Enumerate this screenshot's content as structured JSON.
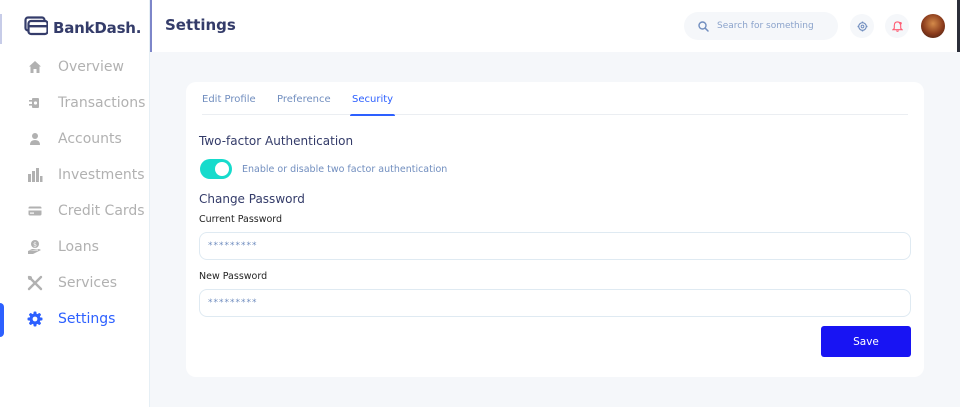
{
  "app": {
    "name": "BankDash."
  },
  "sidebar": {
    "items": [
      {
        "label": "Overview",
        "icon": "home-icon"
      },
      {
        "label": "Transactions",
        "icon": "transfer-icon"
      },
      {
        "label": "Accounts",
        "icon": "user-icon"
      },
      {
        "label": "Investments",
        "icon": "investment-icon"
      },
      {
        "label": "Credit Cards",
        "icon": "credit-card-icon"
      },
      {
        "label": "Loans",
        "icon": "loan-icon"
      },
      {
        "label": "Services",
        "icon": "services-icon"
      },
      {
        "label": "Settings",
        "icon": "gear-icon",
        "active": true
      }
    ]
  },
  "header": {
    "title": "Settings",
    "search_placeholder": "Search for something"
  },
  "tabs": [
    {
      "label": "Edit Profile"
    },
    {
      "label": "Preference"
    },
    {
      "label": "Security",
      "active": true
    }
  ],
  "security": {
    "two_factor_title": "Two-factor Authentication",
    "two_factor_enabled": true,
    "two_factor_label": "Enable or disable two factor authentication",
    "change_password_title": "Change Password",
    "current_password_label": "Current Password",
    "current_password_value": "*********",
    "new_password_label": "New Password",
    "new_password_value": "*********",
    "save_label": "Save"
  },
  "colors": {
    "accent": "#2d60ff",
    "toggle": "#16dbcc",
    "save_button": "#1814f3",
    "muted": "#b1b1b1",
    "text_secondary": "#718ebf"
  }
}
